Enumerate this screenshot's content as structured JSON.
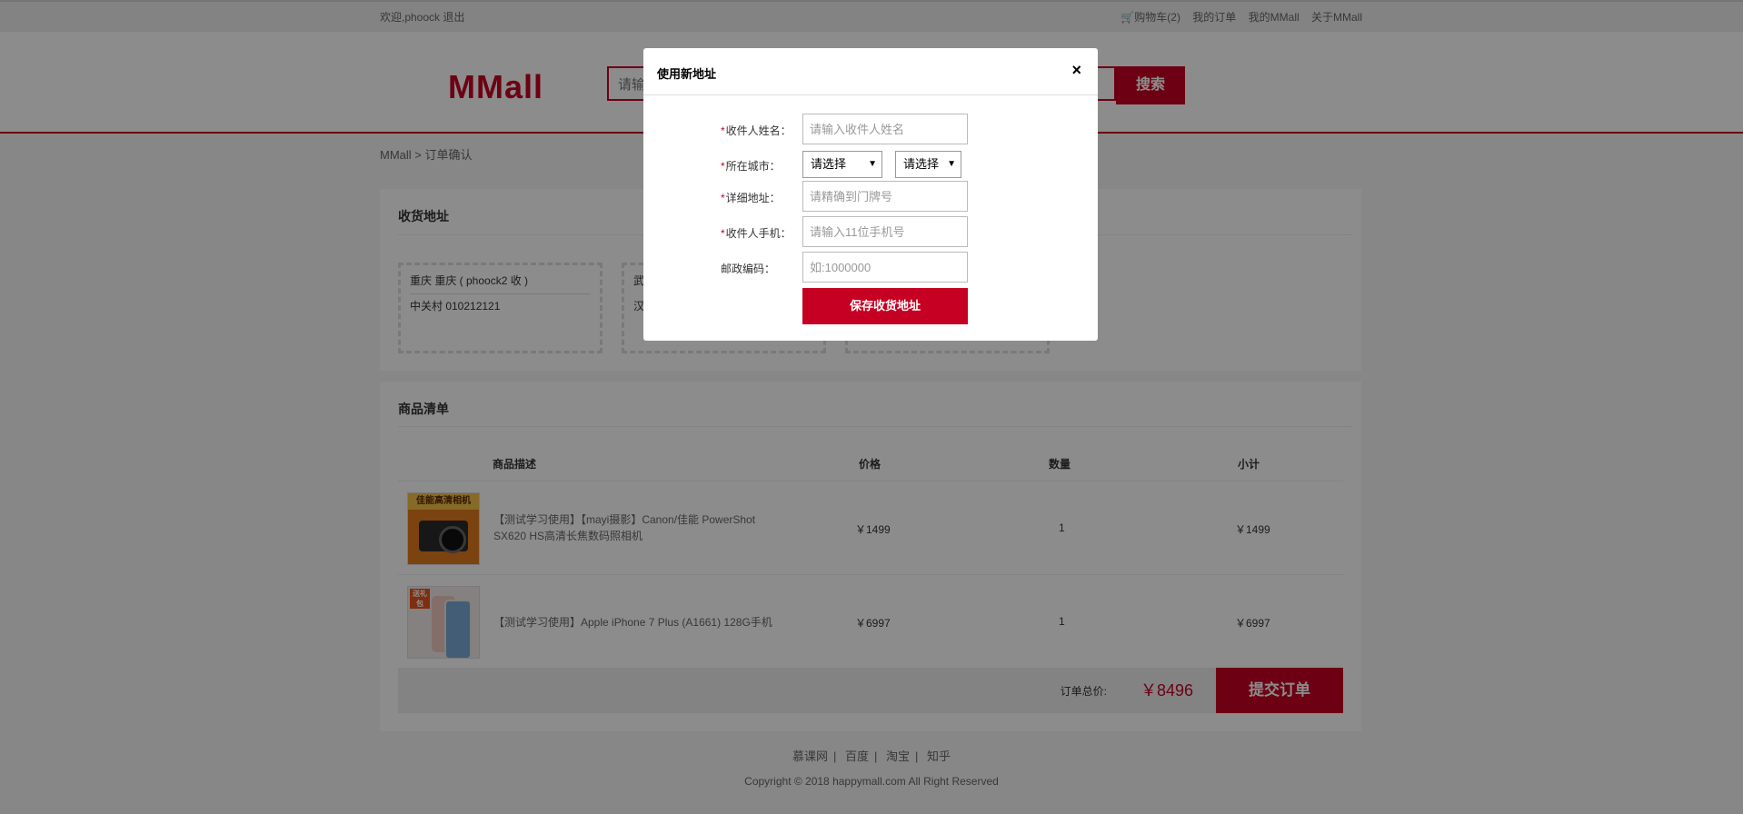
{
  "topbar": {
    "welcome": "欢迎,phoock",
    "logout": "退出",
    "cart": "购物车(2)",
    "orders": "我的订单",
    "my_mmall": "我的MMall",
    "about": "关于MMall"
  },
  "header": {
    "logo": "MMall",
    "search_placeholder": "请输入商品名称",
    "search_button": "搜索"
  },
  "breadcrumb": "MMall > 订单确认",
  "address_section": {
    "title": "收货地址",
    "cards": [
      {
        "name": "重庆 重庆 ( phoock2 收 )",
        "detail": "中关村 010212121"
      },
      {
        "name": "武",
        "detail": "汉"
      },
      {
        "name": "",
        "detail": ""
      }
    ]
  },
  "goods_section": {
    "title": "商品清单",
    "headers": {
      "desc": "商品描述",
      "price": "价格",
      "qty": "数量",
      "subtotal": "小计"
    },
    "rows": [
      {
        "name": "【测试学习使用】【mayi摄影】Canon/佳能 PowerShot SX620 HS高清长焦数码照相机",
        "price": "￥1499",
        "qty": "1",
        "subtotal": "￥1499",
        "thumb_caption": "佳能高清相机",
        "thumb_icon": "camera-image"
      },
      {
        "name": "【测试学习使用】Apple iPhone 7 Plus (A1661) 128G手机",
        "price": "￥6997",
        "qty": "1",
        "subtotal": "￥6997",
        "thumb_caption": "送礼包",
        "thumb_icon": "phone-image"
      }
    ],
    "total_label": "订单总价:",
    "total_value": "￥8496",
    "submit": "提交订单"
  },
  "footer": {
    "links": [
      "慕课网",
      "百度",
      "淘宝",
      "知乎"
    ],
    "copyright": "Copyright © 2018 happymall.com All Right Reserved"
  },
  "modal": {
    "title": "使用新地址",
    "close": "×",
    "fields": {
      "name_label": "收件人姓名：",
      "name_placeholder": "请输入收件人姓名",
      "city_label": "所在城市：",
      "province_value": "请选择",
      "city_value": "请选择",
      "address_label": "详细地址：",
      "address_placeholder": "请精确到门牌号",
      "phone_label": "收件人手机：",
      "phone_placeholder": "请输入11位手机号",
      "zip_label": "邮政编码：",
      "zip_placeholder": "如:1000000"
    },
    "required_mark": "*",
    "save_button": "保存收货地址"
  },
  "colors": {
    "accent": "#c60023",
    "mask": "rgba(0,0,0,0.45)"
  }
}
